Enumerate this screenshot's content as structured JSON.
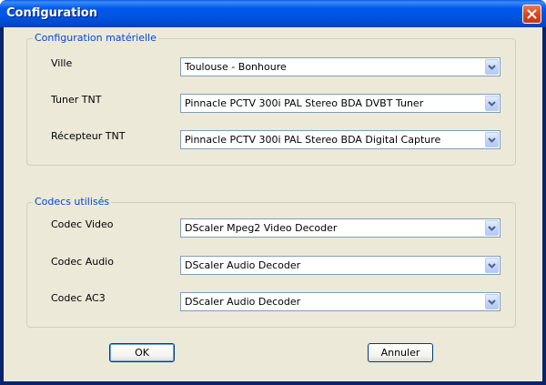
{
  "window": {
    "title": "Configuration"
  },
  "hardware_group": {
    "legend": "Configuration matérielle",
    "rows": [
      {
        "label": "Ville",
        "value": "Toulouse - Bonhoure"
      },
      {
        "label": "Tuner TNT",
        "value": "Pinnacle PCTV 300i PAL Stereo BDA DVBT Tuner"
      },
      {
        "label": "Récepteur TNT",
        "value": "Pinnacle PCTV 300i PAL Stereo BDA Digital Capture"
      }
    ]
  },
  "codecs_group": {
    "legend": "Codecs utilisés",
    "rows": [
      {
        "label": "Codec Video",
        "value": "DScaler Mpeg2 Video Decoder"
      },
      {
        "label": "Codec Audio",
        "value": "DScaler Audio Decoder"
      },
      {
        "label": "Codec AC3",
        "value": "DScaler Audio Decoder"
      }
    ]
  },
  "buttons": {
    "ok": "OK",
    "cancel": "Annuler"
  }
}
